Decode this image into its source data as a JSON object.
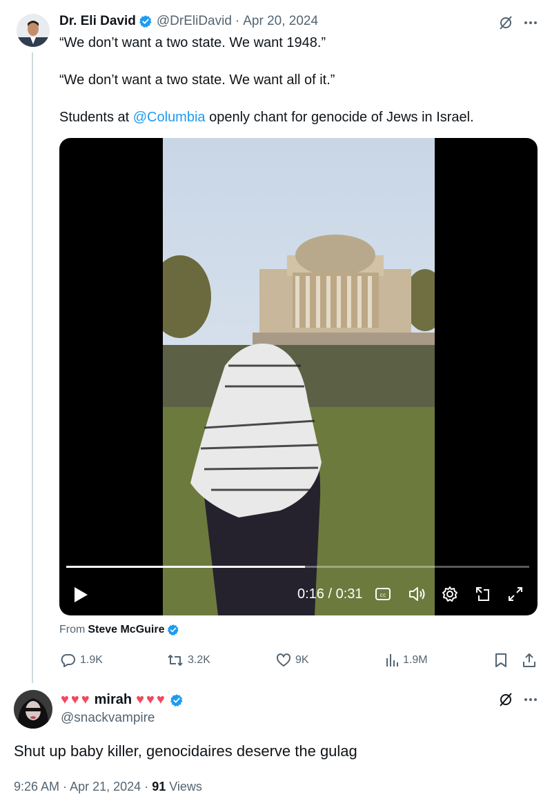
{
  "tweet": {
    "author_name": "Dr. Eli David",
    "handle": "@DrEliDavid",
    "separator": "·",
    "date": "Apr 20, 2024",
    "lines": [
      "“We don’t want a two state. We want 1948.”",
      "“We don’t want a two state. We want all of it.”"
    ],
    "line3_prefix": "Students at ",
    "line3_mention": "@Columbia",
    "line3_suffix": " openly chant for genocide of Jews in Israel."
  },
  "video": {
    "time": "0:16 / 0:31",
    "progress_fraction": 0.516
  },
  "attribution": {
    "prefix": "From",
    "source": "Steve McGuire"
  },
  "actions": {
    "replies": "1.9K",
    "reposts": "3.2K",
    "likes": "9K",
    "views": "1.9M"
  },
  "reply": {
    "hearts_left": "♥♥♥",
    "name": "mirah",
    "hearts_right": "♥♥♥",
    "handle": "@snackvampire",
    "text": "Shut up baby killer, genocidaires deserve the gulag",
    "time": "9:26 AM",
    "separator": "·",
    "date": "Apr 21, 2024",
    "separator2": "·",
    "views_count": "91",
    "views_label": "Views"
  },
  "icons": {
    "verified": "verified-badge-icon",
    "grok": "grok-icon",
    "more": "more-icon",
    "reply": "reply-icon",
    "repost": "repost-icon",
    "like": "like-icon",
    "views": "views-icon",
    "bookmark": "bookmark-icon",
    "share": "share-icon"
  },
  "colors": {
    "accent": "#1d9bf0",
    "secondary_text": "#536471",
    "heart": "#f4475e"
  }
}
